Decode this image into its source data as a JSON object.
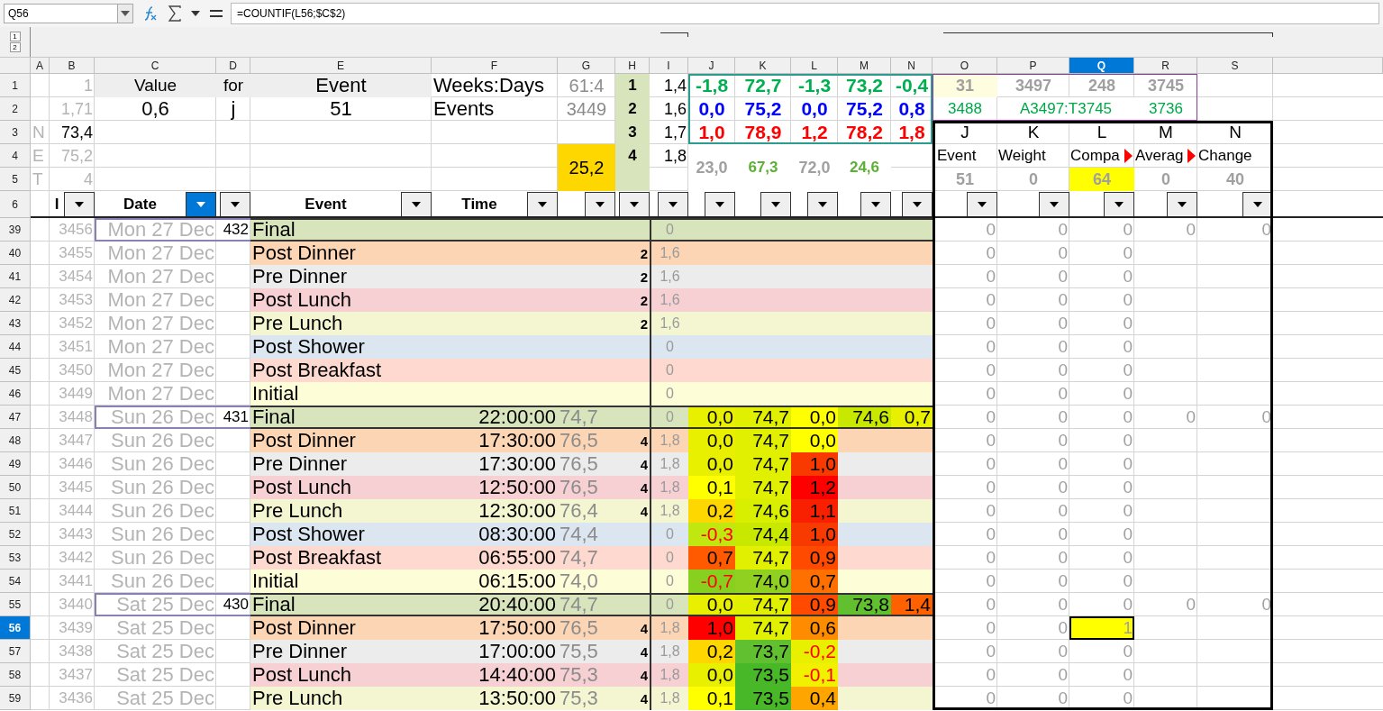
{
  "name_box": "Q56",
  "formula": "=COUNTIF(L56;$C$2)",
  "outline_levels": [
    "1",
    "2"
  ],
  "columns": [
    {
      "label": "A",
      "selected": false
    },
    {
      "label": "B",
      "selected": false
    },
    {
      "label": "C",
      "selected": false
    },
    {
      "label": "D",
      "selected": false
    },
    {
      "label": "E",
      "selected": false
    },
    {
      "label": "F",
      "selected": false
    },
    {
      "label": "G",
      "selected": false
    },
    {
      "label": "H",
      "selected": false
    },
    {
      "label": "I",
      "selected": false
    },
    {
      "label": "J",
      "selected": false
    },
    {
      "label": "K",
      "selected": false
    },
    {
      "label": "L",
      "selected": false
    },
    {
      "label": "M",
      "selected": false
    },
    {
      "label": "N",
      "selected": false
    },
    {
      "label": "O",
      "selected": false
    },
    {
      "label": "P",
      "selected": false
    },
    {
      "label": "Q",
      "selected": true
    },
    {
      "label": "R",
      "selected": false
    },
    {
      "label": "S",
      "selected": false
    }
  ],
  "rows": [
    {
      "header": "1",
      "selected": false,
      "kind": "top",
      "cells": {
        "b": {
          "text": "1",
          "kind": "dim"
        },
        "c": {
          "text": "Value",
          "color": "#eeeeee"
        },
        "d": {
          "text": "for",
          "color": "#eeeeee"
        },
        "e": {
          "text": "Event",
          "kind": "big",
          "color": "#eeeeee"
        },
        "f": {
          "text": "Weeks:Days"
        },
        "g": {
          "text": "61:4"
        },
        "h": {
          "text": "1",
          "kind": "bold",
          "color": "#d8e4bc"
        },
        "i": {
          "text": "1,4"
        },
        "j": {
          "text": "-1,8",
          "kind": "bold-green"
        },
        "k": {
          "text": "72,7",
          "kind": "bold-green"
        },
        "l": {
          "text": "-1,3",
          "kind": "bold-green"
        },
        "m": {
          "text": "73,2",
          "kind": "bold-green"
        },
        "n": {
          "text": "-0,4",
          "kind": "bold-green"
        },
        "o": {
          "text": "31",
          "kind": "grey-bold",
          "color": "#fffde0"
        },
        "p": {
          "text": "3497",
          "kind": "grey-bold"
        },
        "q": {
          "text": "248",
          "kind": "grey-bold"
        },
        "r": {
          "text": "3745",
          "kind": "grey-bold"
        }
      }
    },
    {
      "header": "2",
      "selected": false,
      "kind": "top",
      "cells": {
        "b": {
          "text": "1,71",
          "kind": "dim"
        },
        "c": {
          "text": "0,6",
          "kind": "big"
        },
        "d": {
          "text": "j",
          "kind": "big"
        },
        "e": {
          "text": "51",
          "kind": "big"
        },
        "f": {
          "text": "Events"
        },
        "g": {
          "text": "3449"
        },
        "h": {
          "text": "2",
          "kind": "bold",
          "color": "#d8e4bc"
        },
        "i": {
          "text": "1,6"
        },
        "j": {
          "text": "0,0",
          "kind": "bold-blue"
        },
        "k": {
          "text": "75,2",
          "kind": "bold-blue"
        },
        "l": {
          "text": "0,0",
          "kind": "bold-blue"
        },
        "m": {
          "text": "75,2",
          "kind": "bold-blue"
        },
        "n": {
          "text": "0,8",
          "kind": "bold-blue"
        },
        "o": {
          "text": "3488",
          "kind": "green"
        },
        "p": {
          "text": "A3497:T3745",
          "kind": "green"
        },
        "r": {
          "text": "3736",
          "kind": "green"
        }
      }
    },
    {
      "header": "3",
      "selected": false,
      "kind": "top",
      "cells": {
        "a": {
          "text": "N",
          "kind": "dim"
        },
        "b": {
          "text": "73,4"
        },
        "h": {
          "text": "3",
          "kind": "bold",
          "color": "#d8e4bc"
        },
        "i": {
          "text": "1,7"
        },
        "j": {
          "text": "1,0",
          "kind": "bold-red"
        },
        "k": {
          "text": "78,9",
          "kind": "bold-red"
        },
        "l": {
          "text": "1,2",
          "kind": "bold-red"
        },
        "m": {
          "text": "78,2",
          "kind": "bold-red"
        },
        "n": {
          "text": "1,8",
          "kind": "bold-red"
        },
        "o": {
          "text": "J"
        },
        "p": {
          "text": "K"
        },
        "q": {
          "text": "L"
        },
        "r": {
          "text": "M"
        },
        "s": {
          "text": "N"
        }
      }
    },
    {
      "header": "4",
      "selected": false,
      "kind": "top",
      "cells": {
        "a": {
          "text": "E",
          "kind": "dim"
        },
        "b": {
          "text": "75,2",
          "kind": "dim"
        },
        "g": {
          "text": "25,2",
          "kind": "plain",
          "color": "#ffd700"
        },
        "h": {
          "text": "4",
          "kind": "bold",
          "color": "#d8e4bc"
        },
        "i": {
          "text": "1,8"
        },
        "j": {
          "text": "23,0",
          "kind": "grey-bold"
        },
        "k": {
          "text": "67,3",
          "kind": "light-green"
        },
        "l": {
          "text": "72,0",
          "kind": "grey-bold"
        },
        "m": {
          "text": "24,6",
          "kind": "light-green"
        },
        "o": {
          "text": "Event",
          "kind": "label"
        },
        "p": {
          "text": "Weight",
          "kind": "label"
        },
        "q": {
          "text": "Compa",
          "kind": "label-clipped"
        },
        "r": {
          "text": "Averag",
          "kind": "label-clipped"
        },
        "s": {
          "text": "Change",
          "kind": "label"
        }
      }
    },
    {
      "header": "5",
      "selected": false,
      "kind": "top",
      "cells": {
        "a": {
          "text": "T",
          "kind": "dim"
        },
        "b": {
          "text": "4",
          "kind": "dim"
        },
        "h": {
          "color": "#d8e4bc"
        },
        "o": {
          "text": "51",
          "kind": "grey-bold"
        },
        "p": {
          "text": "0",
          "kind": "grey-bold"
        },
        "q": {
          "text": "64",
          "kind": "grey-bold",
          "color": "#ffff00"
        },
        "r": {
          "text": "0",
          "kind": "grey-bold"
        },
        "s": {
          "text": "40",
          "kind": "grey-bold"
        }
      }
    },
    {
      "header": "6",
      "selected": false,
      "kind": "filter",
      "cells": {
        "b": {
          "text": "I",
          "filter": true,
          "active": false
        },
        "c": {
          "text": "Date",
          "filter": true,
          "active": true
        },
        "d": {
          "filter": true,
          "active": false
        },
        "e": {
          "text": "Event",
          "filter": true,
          "active": false
        },
        "f": {
          "text": "Time",
          "filter": true,
          "active": false
        },
        "g": {
          "filter": true,
          "active": false
        },
        "h": {
          "filter": true,
          "active": false
        },
        "i": {
          "filter": true,
          "active": false
        },
        "j": {
          "filter": true,
          "active": false
        },
        "k": {
          "filter": true,
          "active": false
        },
        "l": {
          "filter": true,
          "active": false
        },
        "m": {
          "filter": true,
          "active": false
        },
        "n": {
          "filter": true,
          "active": false
        },
        "o": {
          "filter": true,
          "active": false
        },
        "p": {
          "filter": true,
          "active": false
        },
        "q": {
          "filter": true,
          "active": false
        },
        "r": {
          "filter": true,
          "active": false
        },
        "s": {
          "filter": true,
          "active": false
        }
      }
    },
    {
      "header": "39",
      "selected": false,
      "kind": "final",
      "color": "#d8e4bc",
      "cells": {
        "b": "3456",
        "c": "Mon 27 Dec",
        "d": "432",
        "e": "Final",
        "i": "0",
        "o": "0",
        "p": "0",
        "q": "0",
        "r": "0",
        "s": "0"
      }
    },
    {
      "header": "40",
      "selected": false,
      "kind": "entry",
      "color": "#fcd5b4",
      "cells": {
        "b": "3455",
        "c": "Mon 27 Dec",
        "e": "Post Dinner",
        "h": "2",
        "i": "1,6",
        "o": "0",
        "p": "0",
        "q": "0"
      }
    },
    {
      "header": "41",
      "selected": false,
      "kind": "entry",
      "color": "#ececec",
      "cells": {
        "b": "3454",
        "c": "Mon 27 Dec",
        "e": "Pre Dinner",
        "h": "2",
        "i": "1,6",
        "o": "0",
        "p": "0",
        "q": "0"
      }
    },
    {
      "header": "42",
      "selected": false,
      "kind": "entry",
      "color": "#f7d0d4",
      "cells": {
        "b": "3453",
        "c": "Mon 27 Dec",
        "e": "Post Lunch",
        "h": "2",
        "i": "1,6",
        "o": "0",
        "p": "0",
        "q": "0"
      }
    },
    {
      "header": "43",
      "selected": false,
      "kind": "entry",
      "color": "#f4f6d2",
      "cells": {
        "b": "3452",
        "c": "Mon 27 Dec",
        "e": "Pre Lunch",
        "h": "2",
        "i": "1,6",
        "o": "0",
        "p": "0",
        "q": "0"
      }
    },
    {
      "header": "44",
      "selected": false,
      "kind": "entry",
      "color": "#dce6f0",
      "cells": {
        "b": "3451",
        "c": "Mon 27 Dec",
        "e": "Post Shower",
        "i": "0",
        "o": "0",
        "p": "0",
        "q": "0"
      }
    },
    {
      "header": "45",
      "selected": false,
      "kind": "entry",
      "color": "#fdd9d0",
      "cells": {
        "b": "3450",
        "c": "Mon 27 Dec",
        "e": "Post Breakfast",
        "i": "0",
        "o": "0",
        "p": "0",
        "q": "0"
      }
    },
    {
      "header": "46",
      "selected": false,
      "kind": "entry",
      "color": "#fdfdd8",
      "cells": {
        "b": "3449",
        "c": "Mon 27 Dec",
        "e": "Initial",
        "i": "0",
        "o": "0",
        "p": "0",
        "q": "0"
      }
    },
    {
      "header": "47",
      "selected": false,
      "kind": "final",
      "color": "#d8e4bc",
      "cells": {
        "b": "3448",
        "c": "Sun 26 Dec",
        "d": "431",
        "e": "Final",
        "f": "22:00:00",
        "g": "74,7",
        "i": "0",
        "j": {
          "text": "0,0",
          "color": "#e8f000"
        },
        "k": {
          "text": "74,7",
          "color": "#e0f000"
        },
        "l": {
          "text": "0,0",
          "color": "#ffff00"
        },
        "m": {
          "text": "74,6",
          "color": "#c8e800"
        },
        "n": {
          "text": "0,7",
          "color": "#e8f000"
        },
        "o": "0",
        "p": "0",
        "q": "0",
        "r": "0",
        "s": "0"
      }
    },
    {
      "header": "48",
      "selected": false,
      "kind": "entry",
      "color": "#fcd5b4",
      "cells": {
        "b": "3447",
        "c": "Sun 26 Dec",
        "e": "Post Dinner",
        "f": "17:30:00",
        "g": "76,5",
        "h": "4",
        "i": "1,8",
        "j": {
          "text": "0,0",
          "color": "#e8f000"
        },
        "k": {
          "text": "74,7",
          "color": "#e0f000"
        },
        "l": {
          "text": "0,0",
          "color": "#ffff00"
        },
        "o": "0",
        "p": "0",
        "q": "0"
      }
    },
    {
      "header": "49",
      "selected": false,
      "kind": "entry",
      "color": "#ececec",
      "cells": {
        "b": "3446",
        "c": "Sun 26 Dec",
        "e": "Pre Dinner",
        "f": "17:30:00",
        "g": "76,5",
        "h": "4",
        "i": "1,8",
        "j": {
          "text": "0,0",
          "color": "#e8f000"
        },
        "k": {
          "text": "74,7",
          "color": "#e0f000"
        },
        "l": {
          "text": "1,0",
          "color": "#f83a00"
        },
        "o": "0",
        "p": "0",
        "q": "0"
      }
    },
    {
      "header": "50",
      "selected": false,
      "kind": "entry",
      "color": "#f7d0d4",
      "cells": {
        "b": "3445",
        "c": "Sun 26 Dec",
        "e": "Post Lunch",
        "f": "12:50:00",
        "g": "76,5",
        "h": "4",
        "i": "1,8",
        "j": {
          "text": "0,1",
          "color": "#ffff00"
        },
        "k": {
          "text": "74,7",
          "color": "#e0f000"
        },
        "l": {
          "text": "1,2",
          "color": "#ff0000"
        },
        "o": "0",
        "p": "0",
        "q": "0"
      }
    },
    {
      "header": "51",
      "selected": false,
      "kind": "entry",
      "color": "#f4f6d2",
      "cells": {
        "b": "3444",
        "c": "Sun 26 Dec",
        "e": "Pre Lunch",
        "f": "12:30:00",
        "g": "76,4",
        "h": "4",
        "i": "1,8",
        "j": {
          "text": "0,2",
          "color": "#ffd700"
        },
        "k": {
          "text": "74,6",
          "color": "#d8f000"
        },
        "l": {
          "text": "1,1",
          "color": "#f82000"
        },
        "o": "0",
        "p": "0",
        "q": "0"
      }
    },
    {
      "header": "52",
      "selected": false,
      "kind": "entry",
      "color": "#dce6f0",
      "cells": {
        "b": "3443",
        "c": "Sun 26 Dec",
        "e": "Post Shower",
        "f": "08:30:00",
        "g": "74,4",
        "i": "0",
        "j": {
          "text": "-0,3",
          "kind": "neg",
          "color": "#c0e810"
        },
        "k": {
          "text": "74,4",
          "color": "#c8e800"
        },
        "l": {
          "text": "1,0",
          "color": "#f83a00"
        },
        "o": "0",
        "p": "0",
        "q": "0"
      }
    },
    {
      "header": "53",
      "selected": false,
      "kind": "entry",
      "color": "#fdd9d0",
      "cells": {
        "b": "3442",
        "c": "Sun 26 Dec",
        "e": "Post Breakfast",
        "f": "06:55:00",
        "g": "74,7",
        "i": "0",
        "j": {
          "text": "0,7",
          "color": "#ff5a00"
        },
        "k": {
          "text": "74,7",
          "color": "#e0f000"
        },
        "l": {
          "text": "0,9",
          "color": "#ff4a00"
        },
        "o": "0",
        "p": "0",
        "q": "0"
      }
    },
    {
      "header": "54",
      "selected": false,
      "kind": "entry",
      "color": "#fdfdd8",
      "cells": {
        "b": "3441",
        "c": "Sun 26 Dec",
        "e": "Initial",
        "f": "06:15:00",
        "g": "74,0",
        "i": "0",
        "j": {
          "text": "-0,7",
          "kind": "neg",
          "color": "#88d020"
        },
        "k": {
          "text": "74,0",
          "color": "#90d020"
        },
        "l": {
          "text": "0,7",
          "color": "#ff7000"
        },
        "o": "0",
        "p": "0",
        "q": "0"
      }
    },
    {
      "header": "55",
      "selected": false,
      "kind": "final",
      "color": "#d8e4bc",
      "cells": {
        "b": "3440",
        "c": "Sat 25 Dec",
        "d": "430",
        "e": "Final",
        "f": "20:40:00",
        "g": "74,7",
        "i": "0",
        "j": {
          "text": "0,0",
          "color": "#e8f000"
        },
        "k": {
          "text": "74,7",
          "color": "#e0f000"
        },
        "l": {
          "text": "0,9",
          "color": "#ff4a00"
        },
        "m": {
          "text": "73,8",
          "color": "#60c030"
        },
        "n": {
          "text": "1,4",
          "color": "#ff6000"
        },
        "o": "0",
        "p": "0",
        "q": "0",
        "r": "0",
        "s": "0"
      }
    },
    {
      "header": "56",
      "selected": true,
      "kind": "entry",
      "color": "#fcd5b4",
      "cells": {
        "b": "3439",
        "c": "Sat 25 Dec",
        "e": "Post Dinner",
        "f": "17:50:00",
        "g": "76,5",
        "h": "4",
        "i": "1,8",
        "j": {
          "text": "1,0",
          "color": "#ff0000"
        },
        "k": {
          "text": "74,7",
          "color": "#e0f000"
        },
        "l": {
          "text": "0,6",
          "color": "#ff8c00"
        },
        "o": "0",
        "p": "0",
        "q": {
          "text": "1",
          "kind": "current",
          "color": "#ffff00"
        }
      }
    },
    {
      "header": "57",
      "selected": false,
      "kind": "entry",
      "color": "#ececec",
      "cells": {
        "b": "3438",
        "c": "Sat 25 Dec",
        "e": "Pre Dinner",
        "f": "17:00:00",
        "g": "75,5",
        "h": "4",
        "i": "1,8",
        "j": {
          "text": "0,2",
          "color": "#ffd700"
        },
        "k": {
          "text": "73,7",
          "color": "#60c030"
        },
        "l": {
          "text": "-0,2",
          "kind": "neg",
          "color": "#e8f000"
        },
        "o": "0",
        "p": "0",
        "q": "0"
      }
    },
    {
      "header": "58",
      "selected": false,
      "kind": "entry",
      "color": "#f7d0d4",
      "cells": {
        "b": "3437",
        "c": "Sat 25 Dec",
        "e": "Post Lunch",
        "f": "14:40:00",
        "g": "75,3",
        "h": "4",
        "i": "1,8",
        "j": {
          "text": "0,0",
          "color": "#e8f000"
        },
        "k": {
          "text": "73,5",
          "color": "#48b828"
        },
        "l": {
          "text": "-0,1",
          "kind": "neg",
          "color": "#f0f000"
        },
        "o": "0",
        "p": "0",
        "q": "0"
      }
    },
    {
      "header": "59",
      "selected": false,
      "kind": "entry",
      "color": "#f4f6d2",
      "cells": {
        "b": "3436",
        "c": "Sat 25 Dec",
        "e": "Pre Lunch",
        "f": "13:50:00",
        "g": "75,3",
        "h": "4",
        "i": "1,8",
        "j": {
          "text": "0,1",
          "color": "#ffff00"
        },
        "k": {
          "text": "73,5",
          "color": "#48b828"
        },
        "l": {
          "text": "0,4",
          "color": "#ffa500"
        },
        "o": "0",
        "p": "0",
        "q": "0"
      }
    }
  ]
}
